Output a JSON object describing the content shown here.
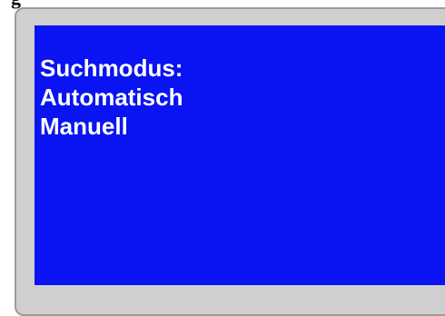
{
  "caption": "g",
  "display": {
    "background_color": "#0a14f2",
    "text_color": "#ffffff",
    "bezel_color": "#cfcfcf",
    "lines": [
      "Suchmodus:",
      "Automatisch",
      "Manuell"
    ]
  }
}
